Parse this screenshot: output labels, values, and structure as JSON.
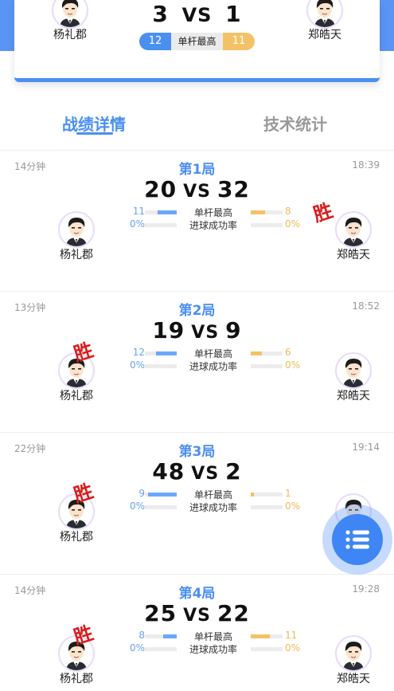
{
  "header": {
    "left_player": "杨礼郡",
    "right_player": "郑皓天",
    "left_score": "3",
    "vs": "VS",
    "right_score": "1",
    "max_break_label": "单杆最高",
    "left_max_break": "12",
    "right_max_break": "11"
  },
  "tabs": [
    {
      "label": "战绩详情",
      "active": true
    },
    {
      "label": "技术统计",
      "active": false
    }
  ],
  "rounds": [
    {
      "title": "第1局",
      "duration": "14分钟",
      "time": "18:39",
      "left_score": "20",
      "vs": "VS",
      "right_score": "32",
      "max_break_label": "单杆最高",
      "left_max_break": "11",
      "right_max_break": "8",
      "left_max_break_fill": 0.6,
      "right_max_break_fill": 0.45,
      "success_label": "进球成功率",
      "left_success": "0%",
      "right_success": "0%",
      "winner": "right",
      "win_label": "胜",
      "left_player": "杨礼郡",
      "right_player": "郑皓天"
    },
    {
      "title": "第2局",
      "duration": "13分钟",
      "time": "18:52",
      "left_score": "19",
      "vs": "VS",
      "right_score": "9",
      "max_break_label": "单杆最高",
      "left_max_break": "12",
      "right_max_break": "6",
      "left_max_break_fill": 0.65,
      "right_max_break_fill": 0.35,
      "success_label": "进球成功率",
      "left_success": "0%",
      "right_success": "0%",
      "winner": "left",
      "win_label": "胜",
      "left_player": "杨礼郡",
      "right_player": "郑皓天"
    },
    {
      "title": "第3局",
      "duration": "22分钟",
      "time": "19:14",
      "left_score": "48",
      "vs": "VS",
      "right_score": "2",
      "max_break_label": "单杆最高",
      "left_max_break": "9",
      "right_max_break": "1",
      "left_max_break_fill": 0.9,
      "right_max_break_fill": 0.1,
      "success_label": "进球成功率",
      "left_success": "0%",
      "right_success": "0%",
      "winner": "left",
      "win_label": "胜",
      "left_player": "杨礼郡",
      "right_player": "郑皓天"
    },
    {
      "title": "第4局",
      "duration": "14分钟",
      "time": "19:28",
      "left_score": "25",
      "vs": "VS",
      "right_score": "22",
      "max_break_label": "单杆最高",
      "left_max_break": "8",
      "right_max_break": "11",
      "left_max_break_fill": 0.42,
      "right_max_break_fill": 0.6,
      "success_label": "进球成功率",
      "left_success": "0%",
      "right_success": "0%",
      "winner": "left",
      "win_label": "胜",
      "left_player": "杨礼郡",
      "right_player": "郑皓天"
    }
  ],
  "fab": {
    "icon": "list-icon"
  },
  "colors": {
    "accent": "#4b8ff1",
    "right_accent": "#f4c266",
    "win": "#d91e1e"
  }
}
